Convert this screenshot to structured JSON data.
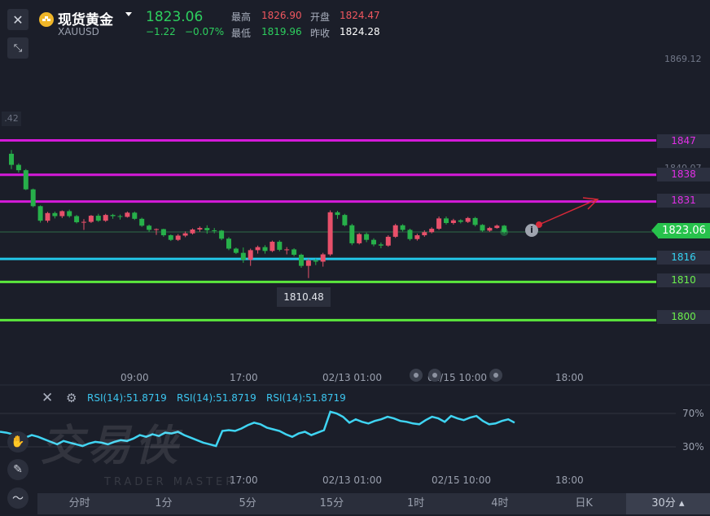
{
  "header": {
    "title": "现货黄金",
    "symbol": "XAUUSD",
    "price": "1823.06",
    "change": "−1.22",
    "change_pct": "−0.07%",
    "high_label": "最高",
    "high_value": "1826.90",
    "open_label": "开盘",
    "open_value": "1824.47",
    "low_label": "最低",
    "low_value": "1819.96",
    "prev_close_label": "昨收",
    "prev_close_value": "1824.28"
  },
  "price_axis": {
    "top_value": "1869.12",
    "mid_value": "1840.07",
    "left_partial": ".42"
  },
  "levels": [
    {
      "label": "1847",
      "color": "#d51ad9",
      "text_color": "#e22fe6"
    },
    {
      "label": "1838",
      "color": "#d51ad9",
      "text_color": "#e22fe6"
    },
    {
      "label": "1831",
      "color": "#d51ad9",
      "text_color": "#e22fe6"
    },
    {
      "label": "1816",
      "color": "#22c7e8",
      "text_color": "#35d3f2"
    },
    {
      "label": "1810",
      "color": "#5be83c",
      "text_color": "#6bf04c"
    },
    {
      "label": "1800",
      "color": "#5be83c",
      "text_color": "#6bf04c"
    }
  ],
  "current_price_badge": "1823.06",
  "low_marker": "1810.48",
  "time_axis": [
    "09:00",
    "17:00",
    "02/13 01:00",
    "02/15 10:00",
    "18:00"
  ],
  "rsi": {
    "labels": [
      "RSI(14):51.8719",
      "RSI(14):51.8719",
      "RSI(14):51.8719"
    ],
    "upper": "70%",
    "lower": "30%",
    "color": "#3fd4f2"
  },
  "timeframes": [
    "分时",
    "1分",
    "5分",
    "15分",
    "1时",
    "4时",
    "日K",
    "30分"
  ],
  "active_timeframe": "30分",
  "watermark": "交易侠",
  "watermark_sub": "TRADER MASTER",
  "chart_data": {
    "type": "candlestick",
    "candles": [
      [
        1843.5,
        1844.5,
        1839.5,
        1840.6
      ],
      [
        1840.6,
        1841.0,
        1838.6,
        1839.2
      ],
      [
        1839.2,
        1839.5,
        1834.0,
        1834.2
      ],
      [
        1834.2,
        1834.4,
        1829.5,
        1829.8
      ],
      [
        1829.8,
        1830.0,
        1825.5,
        1826.0
      ],
      [
        1826.0,
        1828.3,
        1825.5,
        1828.0
      ],
      [
        1828.0,
        1828.4,
        1826.6,
        1827.2
      ],
      [
        1827.2,
        1828.7,
        1826.7,
        1828.5
      ],
      [
        1828.5,
        1828.9,
        1826.8,
        1827.2
      ],
      [
        1827.2,
        1827.5,
        1825.3,
        1825.6
      ],
      [
        1825.6,
        1826.4,
        1823.6,
        1825.7
      ],
      [
        1825.7,
        1827.5,
        1825.4,
        1827.3
      ],
      [
        1827.3,
        1827.8,
        1825.7,
        1826.0
      ],
      [
        1826.0,
        1827.8,
        1825.7,
        1827.5
      ],
      [
        1827.5,
        1827.8,
        1826.5,
        1827.2
      ],
      [
        1827.2,
        1827.6,
        1826.3,
        1827.0
      ],
      [
        1827.0,
        1828.4,
        1826.8,
        1828.1
      ],
      [
        1828.1,
        1828.4,
        1826.2,
        1826.5
      ],
      [
        1826.5,
        1826.8,
        1824.4,
        1824.7
      ],
      [
        1824.7,
        1825.0,
        1823.1,
        1823.6
      ],
      [
        1823.6,
        1824.0,
        1822.3,
        1823.8
      ],
      [
        1823.8,
        1823.9,
        1821.8,
        1822.2
      ],
      [
        1822.2,
        1822.4,
        1820.7,
        1821.0
      ],
      [
        1821.0,
        1822.5,
        1820.7,
        1822.1
      ],
      [
        1822.1,
        1823.2,
        1821.7,
        1822.7
      ],
      [
        1822.7,
        1824.0,
        1822.4,
        1823.7
      ],
      [
        1823.7,
        1824.5,
        1823.1,
        1824.1
      ],
      [
        1824.1,
        1824.8,
        1822.6,
        1823.5
      ],
      [
        1823.5,
        1824.1,
        1822.7,
        1823.4
      ],
      [
        1823.4,
        1823.6,
        1820.9,
        1821.3
      ],
      [
        1821.3,
        1821.7,
        1818.3,
        1818.7
      ],
      [
        1818.7,
        1819.0,
        1817.3,
        1817.6
      ],
      [
        1817.6,
        1819.0,
        1815.0,
        1815.8
      ],
      [
        1815.8,
        1818.7,
        1814.2,
        1818.3
      ],
      [
        1818.3,
        1819.5,
        1817.4,
        1819.1
      ],
      [
        1819.1,
        1819.6,
        1817.4,
        1818.1
      ],
      [
        1818.1,
        1820.8,
        1817.8,
        1820.5
      ],
      [
        1820.5,
        1820.9,
        1818.0,
        1818.4
      ],
      [
        1818.4,
        1819.1,
        1817.2,
        1818.5
      ],
      [
        1818.5,
        1818.8,
        1816.7,
        1817.1
      ],
      [
        1817.1,
        1817.4,
        1813.7,
        1814.2
      ],
      [
        1814.2,
        1816.1,
        1811.0,
        1815.6
      ],
      [
        1815.6,
        1816.1,
        1814.4,
        1815.3
      ],
      [
        1815.3,
        1817.6,
        1814.0,
        1817.2
      ],
      [
        1817.2,
        1828.7,
        1816.8,
        1828.2
      ],
      [
        1828.2,
        1828.6,
        1826.5,
        1827.5
      ],
      [
        1827.5,
        1827.8,
        1824.5,
        1824.8
      ],
      [
        1824.8,
        1825.2,
        1819.6,
        1820.1
      ],
      [
        1820.1,
        1822.8,
        1819.8,
        1822.5
      ],
      [
        1822.5,
        1822.9,
        1820.4,
        1821.0
      ],
      [
        1821.0,
        1821.4,
        1819.3,
        1819.8
      ],
      [
        1819.8,
        1820.3,
        1818.8,
        1819.5
      ],
      [
        1819.5,
        1822.2,
        1819.2,
        1821.8
      ],
      [
        1821.8,
        1825.2,
        1821.5,
        1824.8
      ],
      [
        1824.8,
        1825.1,
        1823.2,
        1823.6
      ],
      [
        1823.6,
        1823.9,
        1820.8,
        1821.2
      ],
      [
        1821.2,
        1822.6,
        1820.8,
        1822.2
      ],
      [
        1822.2,
        1823.5,
        1821.8,
        1823.0
      ],
      [
        1823.0,
        1824.3,
        1822.7,
        1823.9
      ],
      [
        1823.9,
        1827.1,
        1823.6,
        1826.6
      ],
      [
        1826.6,
        1827.1,
        1825.0,
        1825.4
      ],
      [
        1825.4,
        1826.5,
        1825.0,
        1826.1
      ],
      [
        1826.1,
        1826.4,
        1825.3,
        1825.7
      ],
      [
        1825.7,
        1827.0,
        1825.4,
        1826.7
      ],
      [
        1826.7,
        1827.0,
        1824.5,
        1824.9
      ],
      [
        1824.9,
        1825.1,
        1823.1,
        1823.4
      ],
      [
        1823.4,
        1824.4,
        1823.1,
        1824.1
      ],
      [
        1824.1,
        1825.0,
        1823.9,
        1824.7
      ],
      [
        1824.7,
        1824.9,
        1822.7,
        1823.06
      ]
    ],
    "levels": [
      1847,
      1838,
      1831,
      1816,
      1810,
      1800
    ],
    "rsi_values": [
      48,
      47,
      45,
      43,
      41,
      44,
      42,
      39,
      36,
      33,
      37,
      35,
      33,
      31,
      34,
      36,
      35,
      33,
      36,
      38,
      37,
      40,
      44,
      42,
      45,
      43,
      47,
      46,
      48,
      44,
      41,
      38,
      35,
      33,
      31,
      49,
      50,
      49,
      52,
      56,
      59,
      57,
      53,
      51,
      49,
      45,
      42,
      46,
      48,
      44,
      47,
      50,
      72,
      70,
      66,
      59,
      63,
      60,
      58,
      61,
      63,
      66,
      64,
      61,
      60,
      58,
      57,
      62,
      66,
      64,
      60,
      67,
      64,
      62,
      65,
      67,
      61,
      57,
      58,
      61,
      63,
      59
    ]
  }
}
